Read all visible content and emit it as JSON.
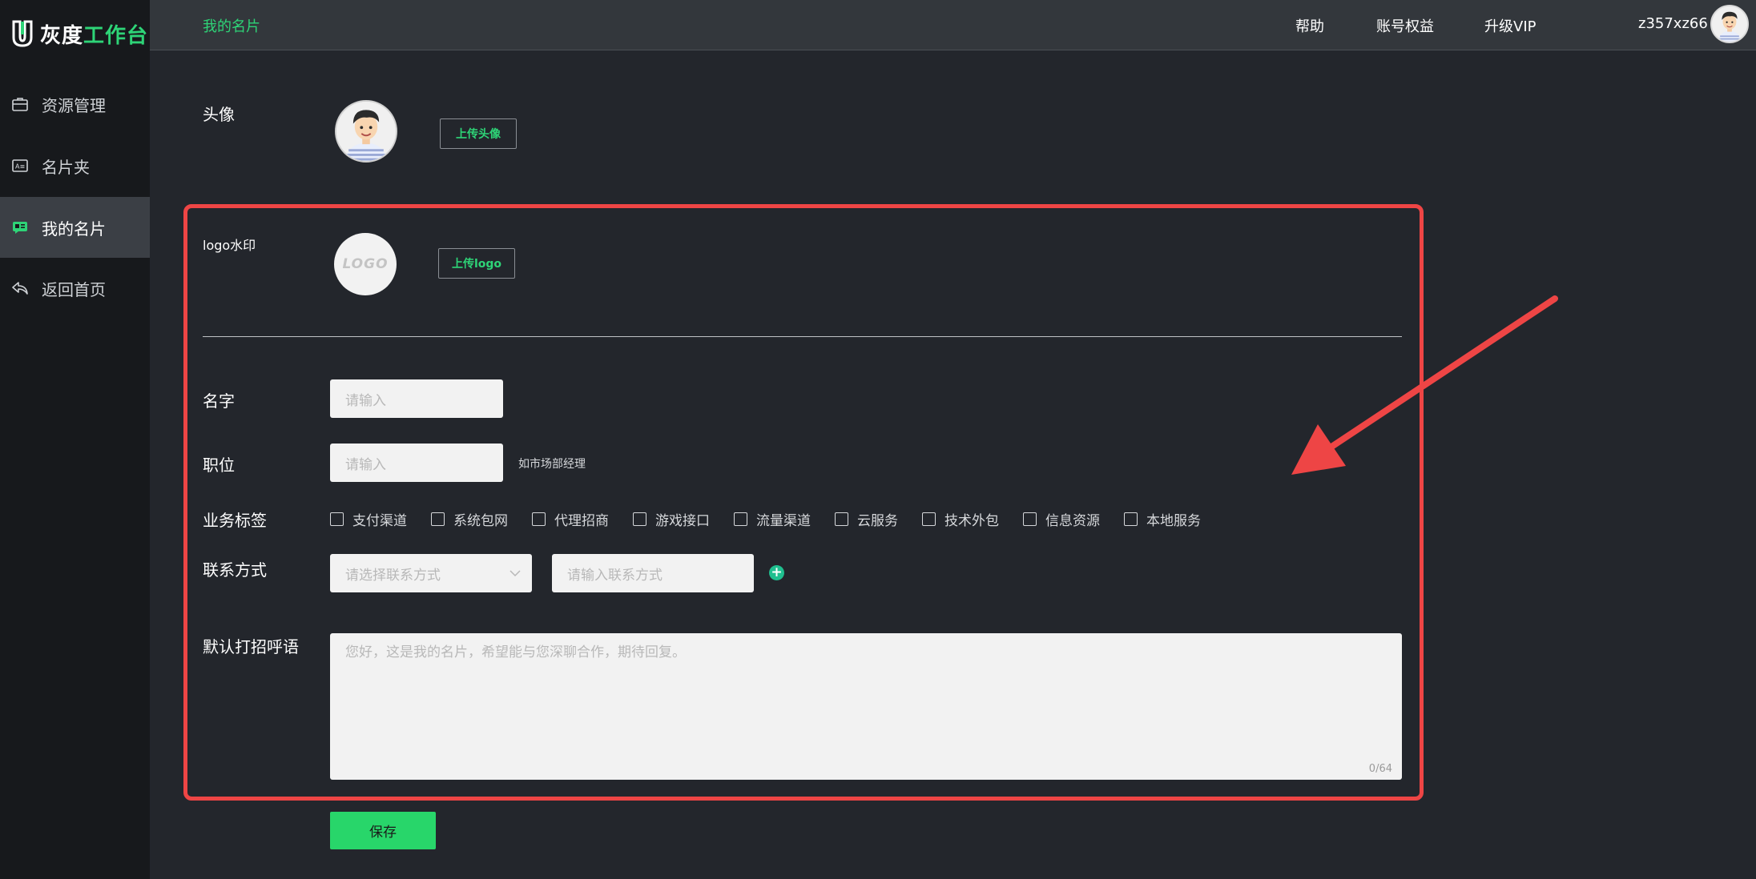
{
  "app": {
    "logo_part1": "灰度",
    "logo_part2": "工作台"
  },
  "sidebar": {
    "items": [
      {
        "label": "资源管理",
        "icon": "briefcase-icon"
      },
      {
        "label": "名片夹",
        "icon": "card-folder-icon"
      },
      {
        "label": "我的名片",
        "icon": "id-card-icon",
        "active": true
      },
      {
        "label": "返回首页",
        "icon": "reply-icon"
      }
    ]
  },
  "topbar": {
    "breadcrumb": "我的名片",
    "links": [
      "帮助",
      "账号权益",
      "升级VIP"
    ],
    "username": "z357xz66"
  },
  "form": {
    "avatar_label": "头像",
    "upload_avatar": "上传头像",
    "logo_label": "logo水印",
    "logo_placeholder": "LOGO",
    "upload_logo": "上传logo",
    "name_label": "名字",
    "name_placeholder": "请输入",
    "position_label": "职位",
    "position_placeholder": "请输入",
    "position_hint": "如市场部经理",
    "tags_label": "业务标签",
    "tags": [
      "支付渠道",
      "系统包网",
      "代理招商",
      "游戏接口",
      "流量渠道",
      "云服务",
      "技术外包",
      "信息资源",
      "本地服务"
    ],
    "contact_label": "联系方式",
    "contact_select_placeholder": "请选择联系方式",
    "contact_input_placeholder": "请输入联系方式",
    "greeting_label": "默认打招呼语",
    "greeting_placeholder": "您好，这是我的名片，希望能与您深聊合作，期待回复。",
    "greeting_counter": "0/64",
    "save": "保存"
  },
  "colors": {
    "accent": "#2ed477",
    "highlight": "#ee4545",
    "sidebar_bg": "#17191c",
    "main_bg": "#23262c"
  }
}
